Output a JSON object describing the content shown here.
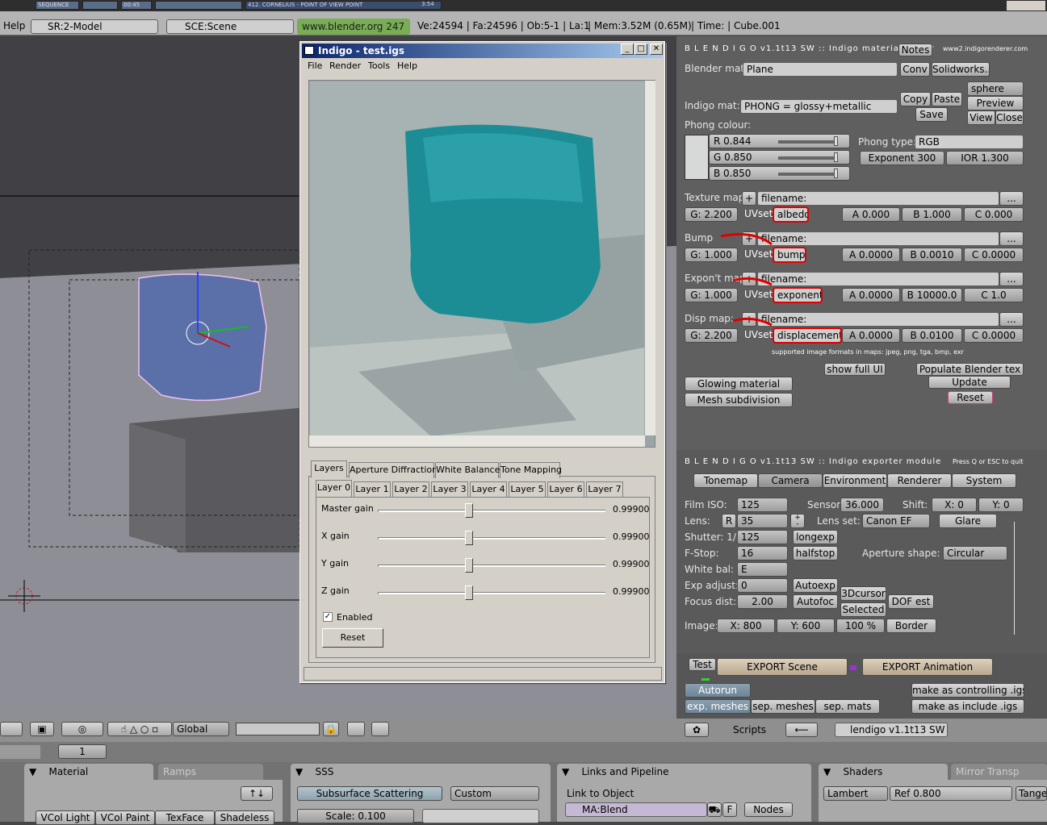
{
  "top_strip": {
    "items": [
      "SEQUENCE",
      "00:45",
      "412. CORNELIUS - POINT OF VIEW POINT",
      "3:54"
    ]
  },
  "info_bar": {
    "help": "Help",
    "screen": "SR:2-Model",
    "scene": "SCE:Scene",
    "site": "www.blender.org 247",
    "stats": "Ve:24594 | Fa:24596 | Ob:5-1 | La:1",
    "mem": "| Mem:3.52M (0.65M)",
    "time": "| Time: | Cube.001"
  },
  "dialog": {
    "title": "Indigo - test.igs",
    "menu": [
      "File",
      "Render",
      "Tools",
      "Help"
    ],
    "tabs": [
      "Layers",
      "Aperture Diffraction",
      "White Balance",
      "Tone Mapping"
    ],
    "layer_tabs": [
      "Layer 0",
      "Layer 1",
      "Layer 2",
      "Layer 3",
      "Layer 4",
      "Layer 5",
      "Layer 6",
      "Layer 7"
    ],
    "gains": [
      {
        "label": "Master gain",
        "value": "0.99900",
        "level": 0.4
      },
      {
        "label": "X gain",
        "value": "0.99900",
        "level": 0.4
      },
      {
        "label": "Y gain",
        "value": "0.99900",
        "level": 0.4
      },
      {
        "label": "Z gain",
        "value": "0.99900",
        "level": 0.4
      }
    ],
    "enabled": "Enabled",
    "reset": "Reset"
  },
  "material_editor": {
    "header": "B L E N D I G O  v1.1t13 SW :: Indigo material editor",
    "notes": "Notes",
    "site": "www2.indigorenderer.com",
    "blender_mat_label": "Blender mat:",
    "blender_mat": "Plane",
    "conv": "Conv",
    "solidworks": "Solidworks..",
    "sphere": "sphere",
    "indigo_mat_label": "Indigo mat:",
    "indigo_mat": "PHONG = glossy+metallic",
    "copy": "Copy",
    "paste": "Paste",
    "save": "Save",
    "preview": "Preview",
    "view": "View",
    "close": "Close",
    "phong_colour": "Phong colour:",
    "r": "R 0.844",
    "g": "G 0.850",
    "b": "B 0.850",
    "phong_type_label": "Phong type:",
    "phong_type": "RGB",
    "exponent": "Exponent 300",
    "ior": "IOR 1.300",
    "maps": [
      {
        "label": "Texture map:",
        "filename": "filename:",
        "g": "G: 2.200",
        "uvset": "UVset",
        "name": "albedo",
        "a": "A 0.000",
        "b": "B 1.000",
        "c": "C 0.000"
      },
      {
        "label": "Bump",
        "filename": "filename:",
        "g": "G: 1.000",
        "uvset": "UVset",
        "name": "bump",
        "a": "A 0.0000",
        "b": "B 0.0010",
        "c": "C 0.0000"
      },
      {
        "label": "Expon't map",
        "filename": "filename:",
        "g": "G: 1.000",
        "uvset": "UVset",
        "name": "exponent",
        "a": "A 0.0000",
        "b": "B 10000.0",
        "c": "C 1.0"
      },
      {
        "label": "Disp map:",
        "filename": "filename:",
        "g": "G: 2.200",
        "uvset": "UVset",
        "name": "displacement",
        "a": "A 0.0000",
        "b": "B 0.0100",
        "c": "C 0.0000"
      }
    ],
    "plus": "+",
    "dots": "...",
    "supported": "supported image formats in maps: jpeg, png, tga, bmp, exr",
    "show_full_ui": "show full UI",
    "populate": "Populate Blender tex",
    "update": "Update",
    "reset": "Reset",
    "glowing": "Glowing material",
    "mesh_sub": "Mesh subdivision"
  },
  "exporter": {
    "header": "B L E N D I G O  v1.1t13 SW :: Indigo exporter module",
    "quit_hint": "Press Q or ESC to quit",
    "tabs": [
      "Tonemap",
      "Camera",
      "Environment",
      "Renderer",
      "System"
    ],
    "film_iso_label": "Film ISO:",
    "film_iso": "125",
    "sensor_label": "Sensor:",
    "sensor": "36.000",
    "shift_label": "Shift:",
    "shift_x": "X: 0",
    "shift_y": "Y: 0",
    "lens_label": "Lens:",
    "lens_r": "R",
    "lens": "35",
    "lens_set_label": "Lens set:",
    "lens_set": "Canon EF",
    "glare": "Glare",
    "shutter_label": "Shutter:  1/",
    "shutter": "125",
    "longexp": "longexp",
    "fstop_label": "F-Stop:",
    "fstop": "16",
    "halfstop": "halfstop",
    "aperture_label": "Aperture shape:",
    "aperture": "Circular",
    "white_bal_label": "White bal:",
    "white_bal": "E",
    "exp_adjust_label": "Exp adjust:",
    "exp_adjust": "0",
    "autoexp": "Autoexp",
    "cursor3d": "3Dcursor",
    "focus_label": "Focus dist:",
    "focus": "2.00",
    "autofoc": "Autofoc",
    "selected": "Selected",
    "dof_est": "DOF est",
    "image_label": "Image:",
    "image_x": "X: 800",
    "image_y": "Y: 600",
    "image_pct": "100 %",
    "border": "Border",
    "test": "Test",
    "export_scene": "EXPORT Scene",
    "export_anim": "EXPORT Animation",
    "autorun": "Autorun",
    "exp_meshes": "exp. meshes",
    "sep_meshes": "sep. meshes",
    "sep_mats": "sep. mats",
    "make_controlling": "make as controlling .igs",
    "make_include": "make as include .igs"
  },
  "script_header": {
    "scripts": "Scripts",
    "script_name": "lendigo v1.1t13 SW"
  },
  "viewport_header": {
    "global": "Global"
  },
  "frame": {
    "value": "1"
  },
  "bottom_panels": {
    "material": "Material",
    "ramps": "Ramps",
    "vcol": [
      "VCol Light",
      "VCol Paint",
      "TexFace",
      "Shadeless"
    ],
    "sss": "SSS",
    "sss_btn": "Subsurface Scattering",
    "sss_preset": "Custom",
    "scale": "Scale: 0.100",
    "links": "Links and Pipeline",
    "link_obj": "Link to Object",
    "ma_blend": "MA:Blend",
    "f": "F",
    "nodes": "Nodes",
    "shaders": "Shaders",
    "mirror": "Mirror Transp",
    "lambert": "Lambert",
    "ref": "Ref  0.800",
    "tang": "Tange"
  }
}
